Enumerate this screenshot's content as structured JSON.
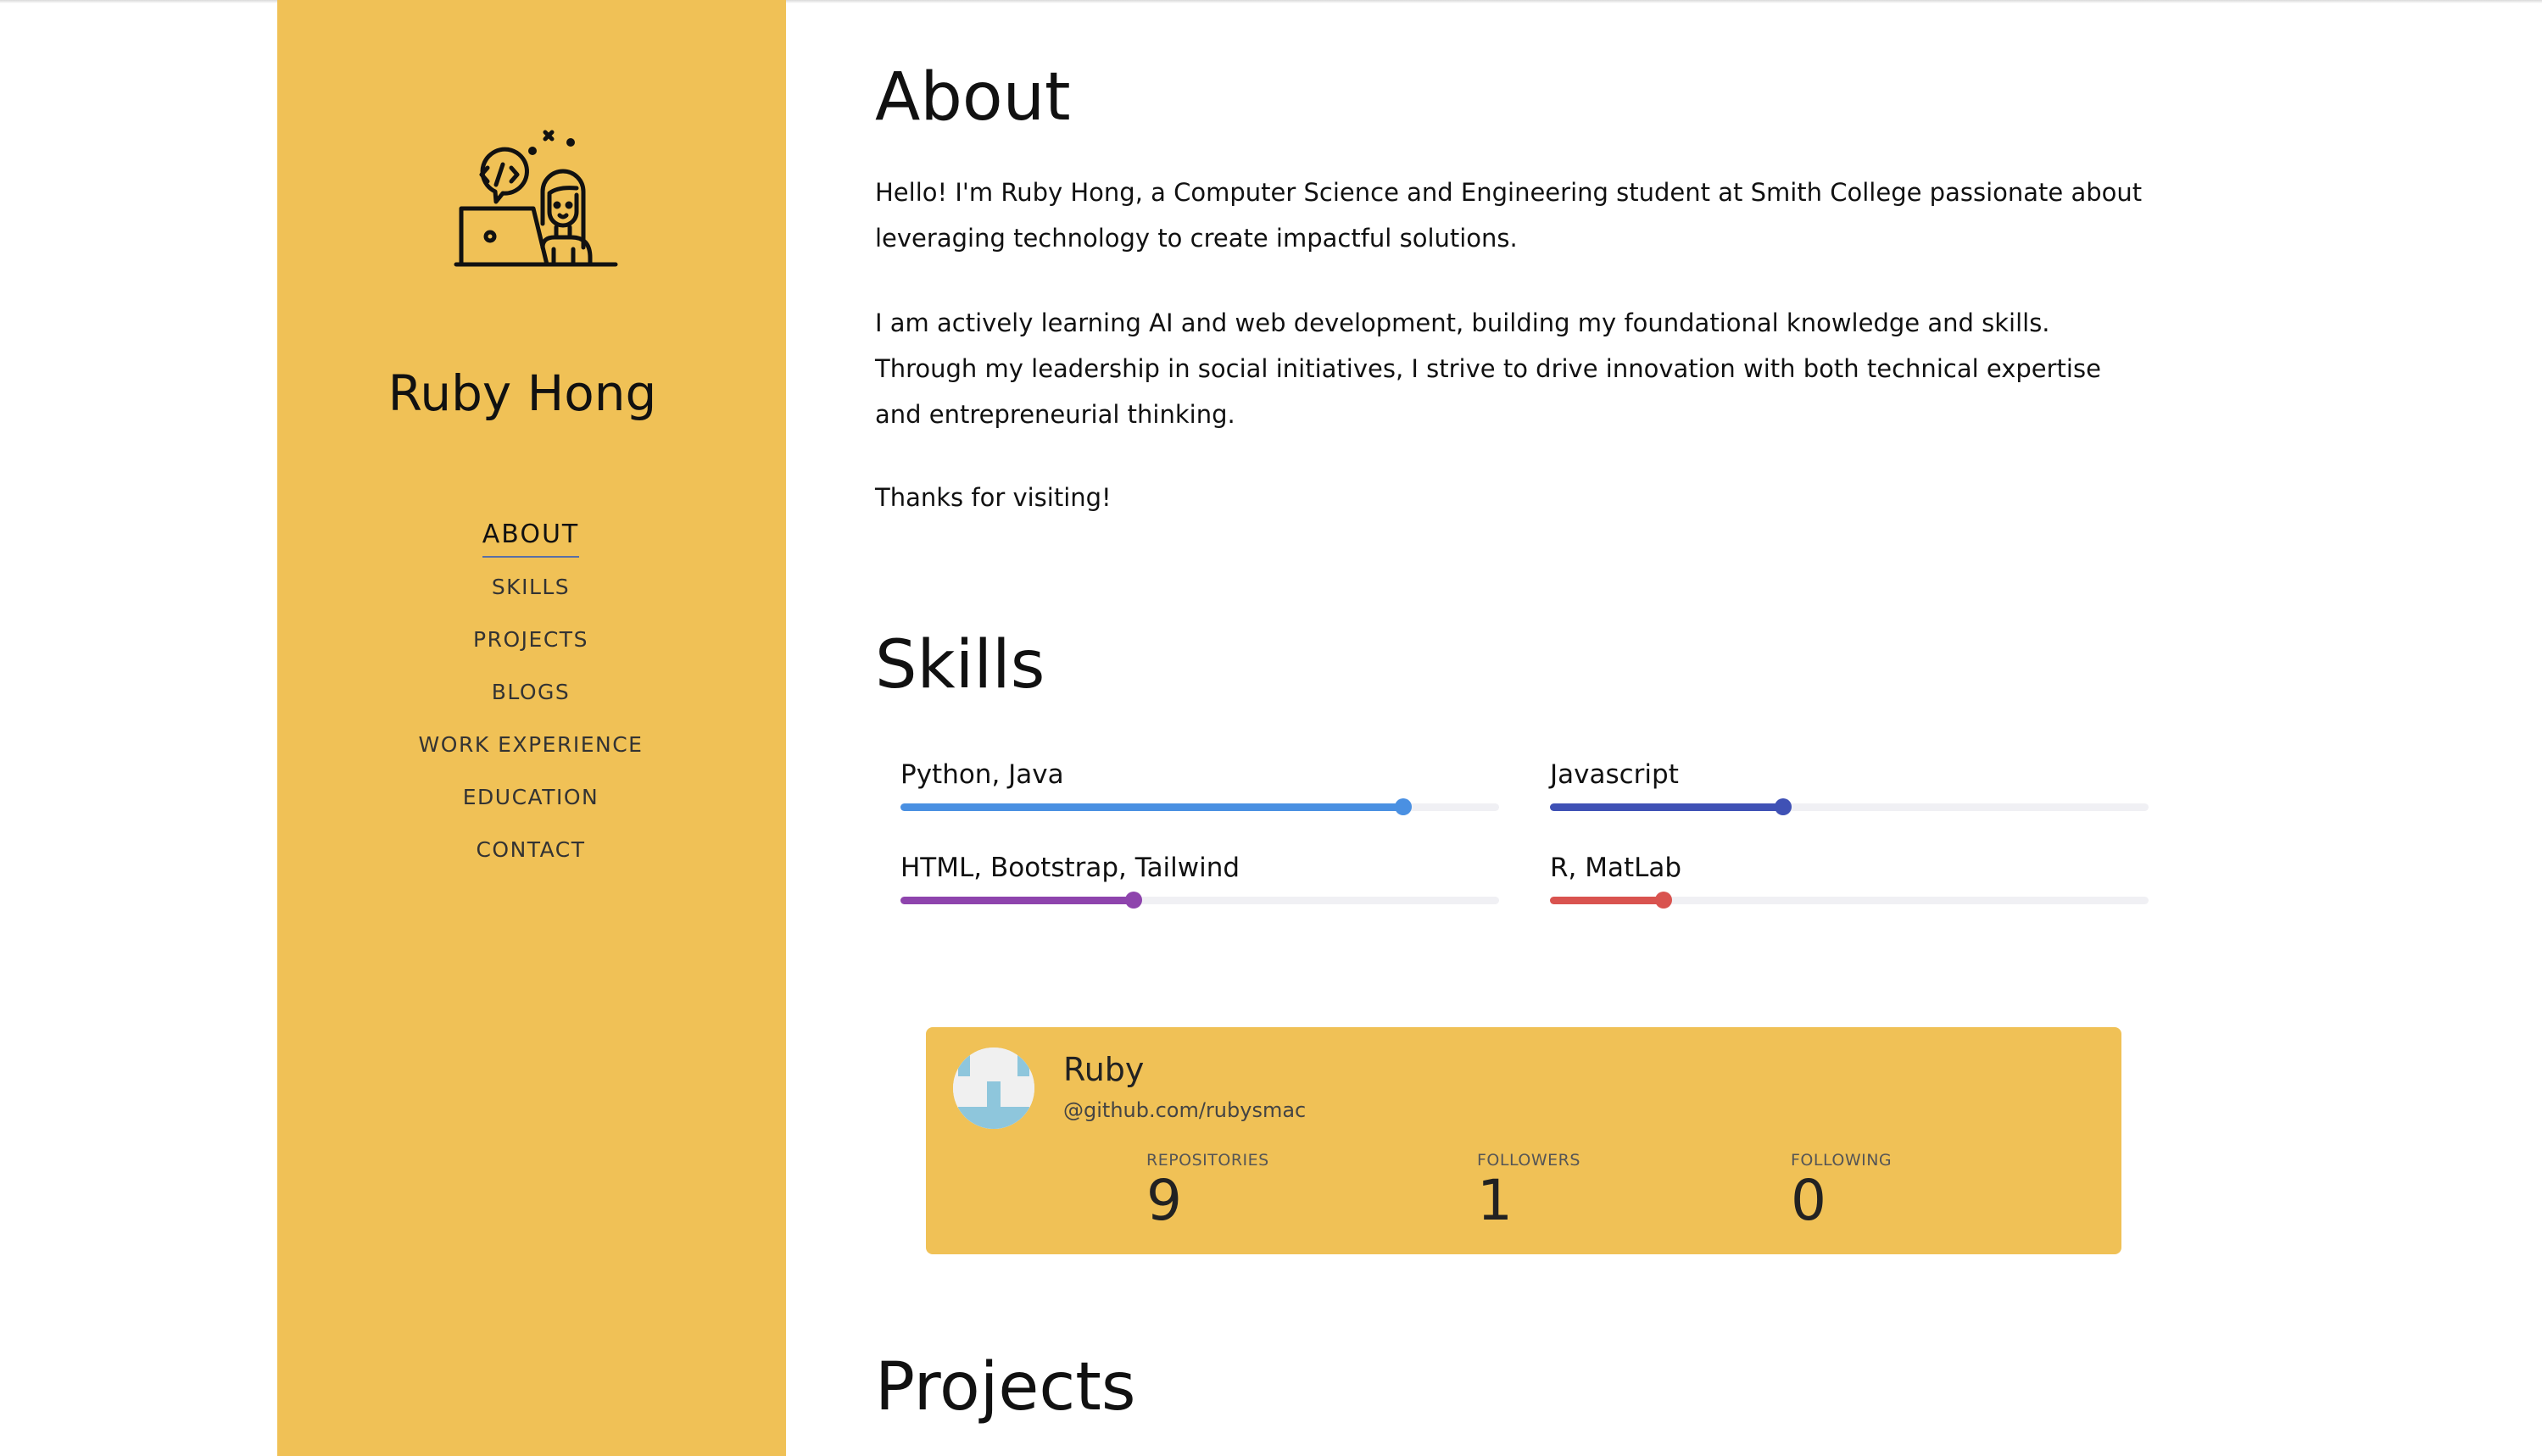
{
  "sidebar": {
    "name": "Ruby Hong",
    "logo_icon": "developer-girl-laptop-icon",
    "nav": [
      {
        "label": "ABOUT",
        "active": true
      },
      {
        "label": "SKILLS",
        "active": false
      },
      {
        "label": "PROJECTS",
        "active": false
      },
      {
        "label": "BLOGS",
        "active": false
      },
      {
        "label": "WORK EXPERIENCE",
        "active": false
      },
      {
        "label": "EDUCATION",
        "active": false
      },
      {
        "label": "CONTACT",
        "active": false
      }
    ]
  },
  "about": {
    "title": "About",
    "paragraphs": [
      "Hello! I'm Ruby Hong, a Computer Science and Engineering student at Smith College passionate about leveraging technology to create impactful solutions.",
      "I am actively learning AI and web development, building my foundational knowledge and skills. Through my leadership in social initiatives, I strive to drive innovation with both technical expertise and entrepreneurial thinking.",
      "Thanks for visiting!"
    ]
  },
  "skills": {
    "title": "Skills",
    "items": [
      {
        "label": "Python, Java",
        "level": 0.84,
        "color": "#4a90e2"
      },
      {
        "label": "Javascript",
        "level": 0.39,
        "color": "#3f51b5"
      },
      {
        "label": "HTML, Bootstrap, Tailwind",
        "level": 0.39,
        "color": "#8e44ad"
      },
      {
        "label": "R, MatLab",
        "level": 0.19,
        "color": "#d9534f"
      }
    ]
  },
  "github": {
    "name": "Ruby",
    "handle": "@github.com/rubysmac",
    "stats": [
      {
        "label": "REPOSITORIES",
        "value": "9"
      },
      {
        "label": "FOLLOWERS",
        "value": "1"
      },
      {
        "label": "FOLLOWING",
        "value": "0"
      }
    ]
  },
  "projects": {
    "title": "Projects"
  },
  "colors": {
    "sidebar_bg": "#f0c156",
    "card_bg": "#f0c156",
    "nav_underline": "#5a6fa5"
  }
}
